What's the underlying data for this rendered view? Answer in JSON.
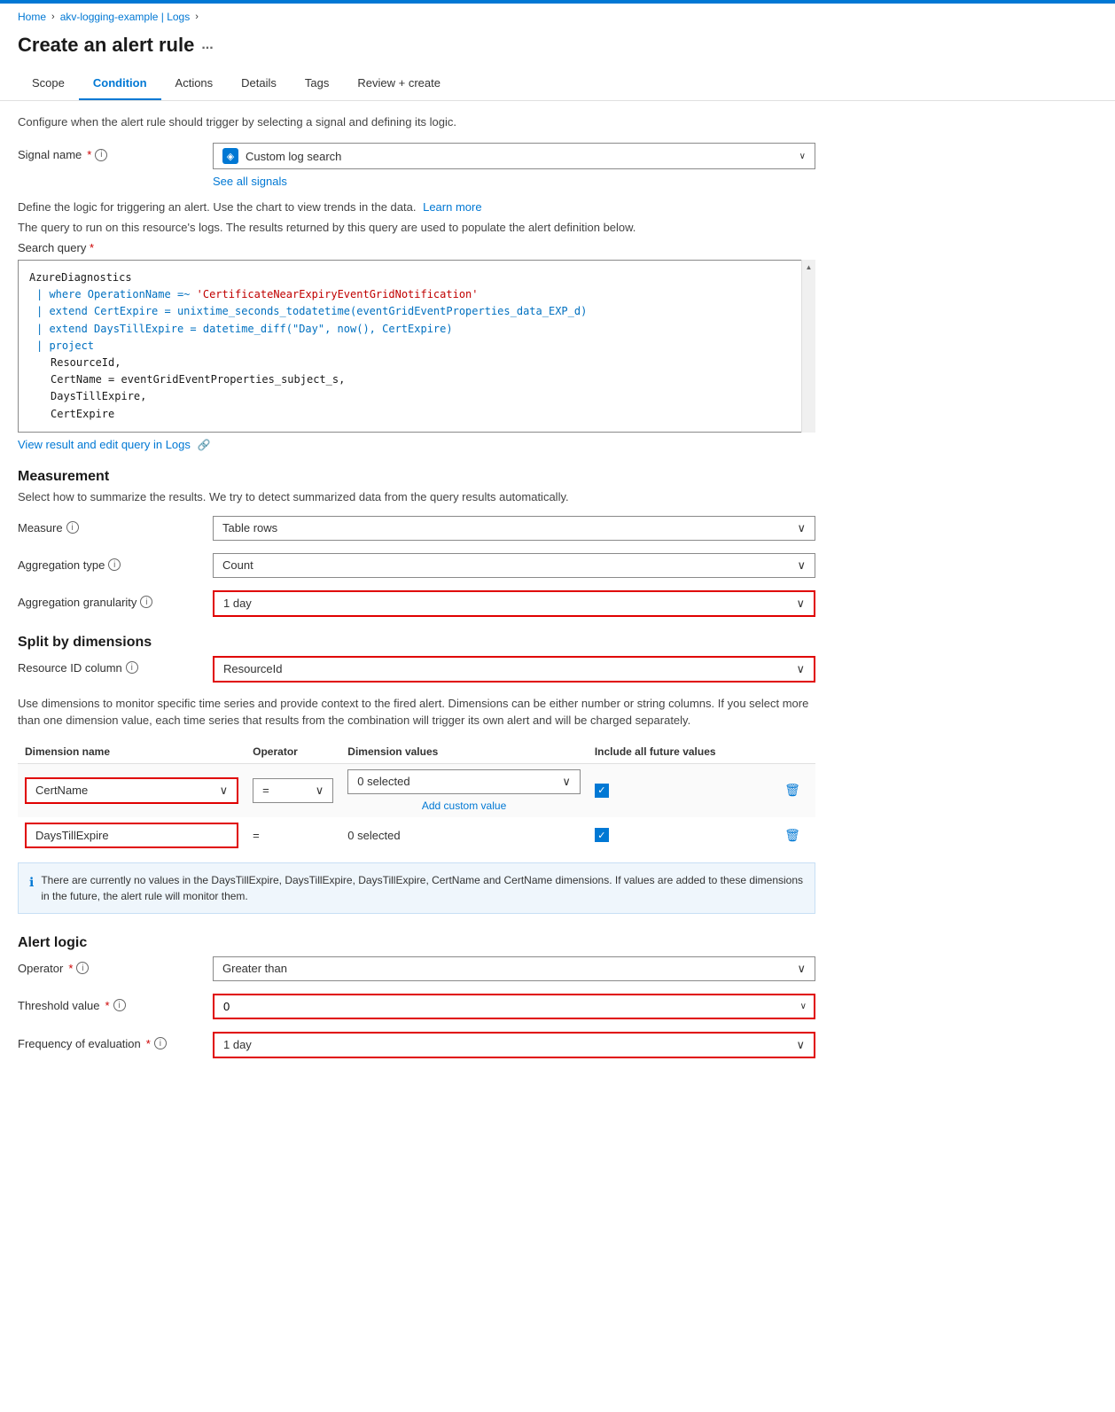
{
  "topbar": {
    "color": "#0078d4"
  },
  "breadcrumb": {
    "items": [
      "Home",
      "akv-logging-example | Logs"
    ]
  },
  "page": {
    "title": "Create an alert rule",
    "dots": "..."
  },
  "tabs": [
    {
      "label": "Scope",
      "active": false
    },
    {
      "label": "Condition",
      "active": true
    },
    {
      "label": "Actions",
      "active": false
    },
    {
      "label": "Details",
      "active": false
    },
    {
      "label": "Tags",
      "active": false
    },
    {
      "label": "Review + create",
      "active": false
    }
  ],
  "condition": {
    "desc": "Configure when the alert rule should trigger by selecting a signal and defining its logic.",
    "signal_label": "Signal name",
    "signal_value": "Custom log search",
    "see_all_signals": "See all signals",
    "alert_desc1": "Define the logic for triggering an alert. Use the chart to view trends in the data.",
    "learn_more": "Learn more",
    "alert_desc2": "The query to run on this resource's logs. The results returned by this query are used to populate the alert definition below.",
    "search_query_label": "Search query",
    "query_lines": [
      {
        "text": "AzureDiagnostics",
        "class": "kw-white",
        "indent": 0
      },
      {
        "text": "| where OperationName =~ ",
        "class": "kw-blue",
        "inline2": "'CertificateNearExpiryEventGridNotification'",
        "class2": "kw-string",
        "indent": 1
      },
      {
        "text": "| extend CertExpire = unixtime_seconds_todatetime(eventGridEventProperties_data_EXP_d)",
        "class": "kw-blue",
        "indent": 1
      },
      {
        "text": "| extend DaysTillExpire = datetime_diff(\"Day\", now(), CertExpire)",
        "class": "kw-blue",
        "indent": 1
      },
      {
        "text": "| project",
        "class": "kw-blue",
        "indent": 1
      },
      {
        "text": "ResourceId,",
        "class": "kw-white",
        "indent": 3
      },
      {
        "text": "CertName = eventGridEventProperties_subject_s,",
        "class": "kw-white",
        "indent": 3
      },
      {
        "text": "DaysTillExpire,",
        "class": "kw-white",
        "indent": 3
      },
      {
        "text": "CertExpire",
        "class": "kw-white",
        "indent": 3
      }
    ],
    "view_result_link": "View result and edit query in Logs",
    "measurement": {
      "heading": "Measurement",
      "desc": "Select how to summarize the results. We try to detect summarized data from the query results automatically.",
      "measure_label": "Measure",
      "measure_value": "Table rows",
      "agg_type_label": "Aggregation type",
      "agg_type_value": "Count",
      "agg_gran_label": "Aggregation granularity",
      "agg_gran_value": "1 day"
    },
    "split": {
      "heading": "Split by dimensions",
      "resource_id_label": "Resource ID column",
      "resource_id_value": "ResourceId",
      "desc": "Use dimensions to monitor specific time series and provide context to the fired alert. Dimensions can be either number or string columns. If you select more than one dimension value, each time series that results from the combination will trigger its own alert and will be charged separately.",
      "table_headers": [
        "Dimension name",
        "Operator",
        "Dimension values",
        "Include all future values"
      ],
      "rows": [
        {
          "name": "CertName",
          "operator": "=",
          "values": "0 selected",
          "include_future": true,
          "add_custom": "Add custom value",
          "highlighted": true
        },
        {
          "name": "DaysTillExpire",
          "operator": "=",
          "values": "0 selected",
          "include_future": true,
          "highlighted": true
        }
      ],
      "info_text": "There are currently no values in the DaysTillExpire, DaysTillExpire, DaysTillExpire, CertName and CertName dimensions. If values are added to these dimensions in the future, the alert rule will monitor them."
    },
    "alert_logic": {
      "heading": "Alert logic",
      "operator_label": "Operator",
      "operator_value": "Greater than",
      "threshold_label": "Threshold value",
      "threshold_value": "0",
      "frequency_label": "Frequency of evaluation",
      "frequency_value": "1 day"
    }
  }
}
